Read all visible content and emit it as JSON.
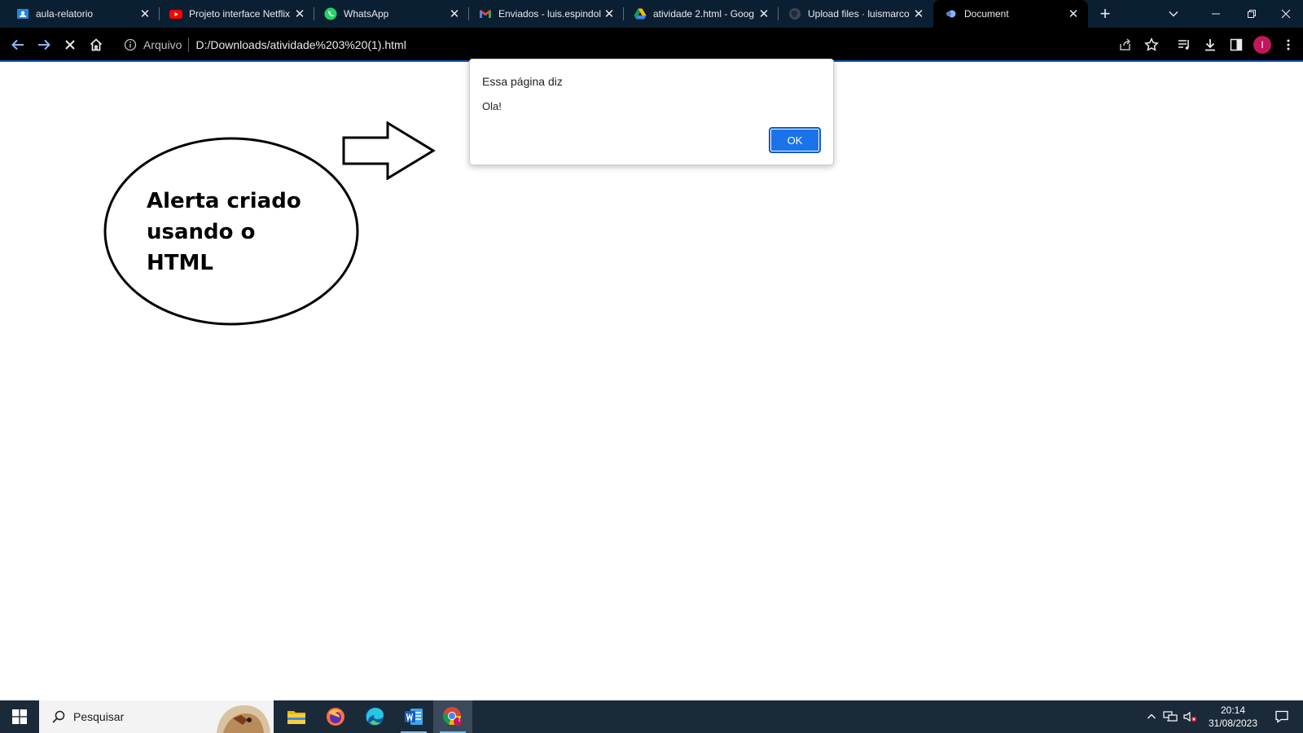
{
  "browser": {
    "tabs": [
      {
        "title": "aula-relatorio",
        "icon": "google-classroom-icon"
      },
      {
        "title": "Projeto interface Netflix",
        "icon": "youtube-icon"
      },
      {
        "title": "WhatsApp",
        "icon": "whatsapp-icon"
      },
      {
        "title": "Enviados - luis.espindol",
        "icon": "gmail-icon"
      },
      {
        "title": "atividade 2.html - Goog",
        "icon": "google-drive-icon"
      },
      {
        "title": "Upload files · luismarco",
        "icon": "github-icon"
      },
      {
        "title": "Document",
        "icon": "globe-icon",
        "active": true
      }
    ],
    "new_tab_label": "+",
    "address_bar": {
      "security_chip": "Arquivo",
      "url": "D:/Downloads/atividade%203%20(1).html"
    },
    "profile_initial": "I",
    "colors": {
      "tabstrip_bg": "#0b1f33",
      "toolbar_bg": "#000000",
      "accent": "#1a73e8",
      "profile": "#c2185b"
    }
  },
  "page": {
    "bubble_text": "Alerta criado\nusando o\nHTML"
  },
  "dialog": {
    "title": "Essa página diz",
    "message": "Ola!",
    "ok_label": "OK"
  },
  "taskbar": {
    "search_placeholder": "Pesquisar",
    "apps": [
      "file-explorer-icon",
      "firefox-icon",
      "edge-icon",
      "word-icon",
      "chrome-icon"
    ],
    "chrome_badge": "I",
    "time": "20:14",
    "date": "31/08/2023"
  }
}
